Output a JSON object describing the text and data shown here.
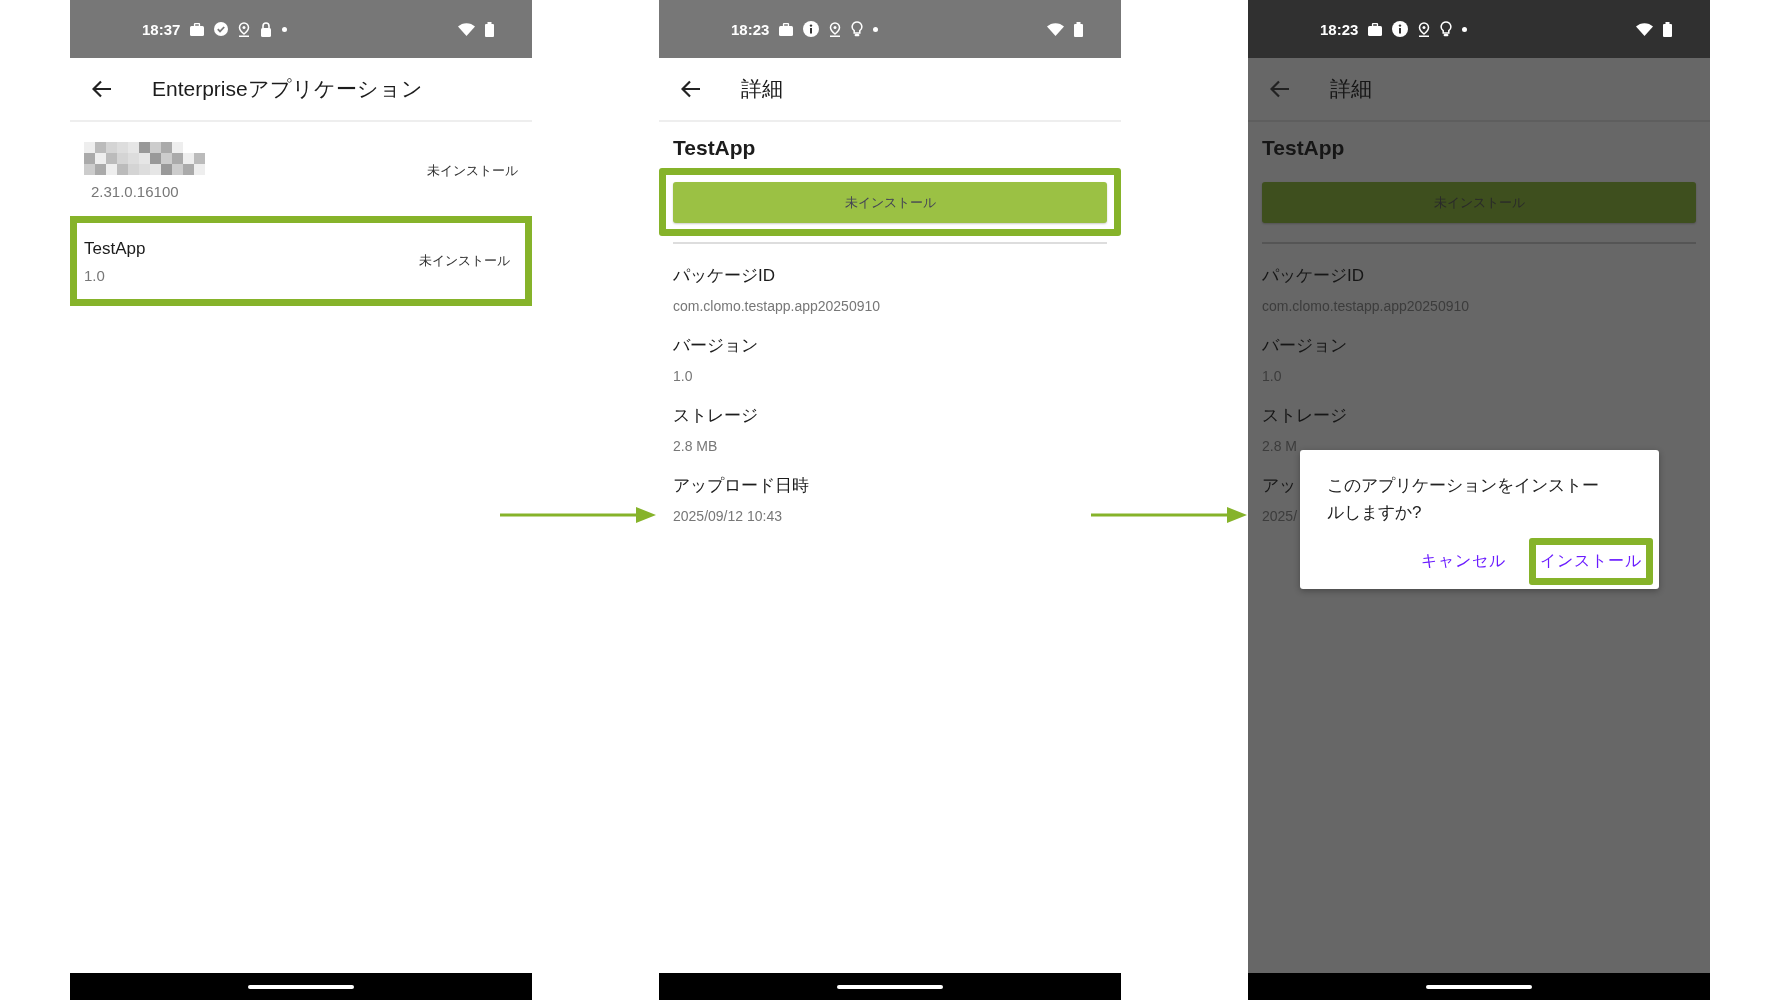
{
  "phones": [
    {
      "kind": "list",
      "dimmed": false,
      "status_bar": {
        "time": "18:37",
        "icons": [
          {
            "kind": "briefcase"
          },
          {
            "kind": "check"
          },
          {
            "kind": "location"
          },
          {
            "kind": "lock"
          },
          {
            "kind": "dot"
          }
        ]
      },
      "app_bar": {
        "title": "Enterpriseアプリケーション"
      },
      "apps": [
        {
          "redacted": true,
          "version": "2.31.0.16100",
          "status": "未インストール",
          "highlighted": false
        },
        {
          "redacted": false,
          "name": "TestApp",
          "version": "1.0",
          "status": "未インストール",
          "highlighted": true
        }
      ]
    },
    {
      "kind": "detail",
      "dimmed": false,
      "status_bar": {
        "time": "18:23",
        "icons": [
          {
            "kind": "briefcase"
          },
          {
            "kind": "info"
          },
          {
            "kind": "location"
          },
          {
            "kind": "bulb"
          },
          {
            "kind": "dot"
          }
        ]
      },
      "app_bar": {
        "title": "詳細"
      },
      "app_name": "TestApp",
      "status_button": {
        "label": "未インストール",
        "highlighted": true
      },
      "fields": [
        {
          "label": "パッケージID",
          "value": "com.clomo.testapp.app20250910"
        },
        {
          "label": "バージョン",
          "value": "1.0"
        },
        {
          "label": "ストレージ",
          "value": "2.8 MB"
        },
        {
          "label": "アップロード日時",
          "value": "2025/09/12 10:43"
        }
      ]
    },
    {
      "kind": "detail",
      "dimmed": true,
      "status_bar": {
        "time": "18:23",
        "icons": [
          {
            "kind": "briefcase"
          },
          {
            "kind": "info"
          },
          {
            "kind": "location"
          },
          {
            "kind": "bulb"
          },
          {
            "kind": "dot"
          }
        ]
      },
      "app_bar": {
        "title": "詳細"
      },
      "app_name": "TestApp",
      "status_button": {
        "label": "未インストール",
        "highlighted": false
      },
      "fields": [
        {
          "label": "パッケージID",
          "value": "com.clomo.testapp.app20250910"
        },
        {
          "label": "バージョン",
          "value": "1.0"
        },
        {
          "label": "ストレージ",
          "value": "2.8 M"
        },
        {
          "label": "アッ",
          "value": "2025/"
        }
      ],
      "dialog": {
        "message": "このアプリケーションをインストールしますか?",
        "buttons": [
          {
            "label": "キャンセル",
            "highlighted": false
          },
          {
            "label": "インストール",
            "highlighted": true
          }
        ]
      }
    }
  ]
}
